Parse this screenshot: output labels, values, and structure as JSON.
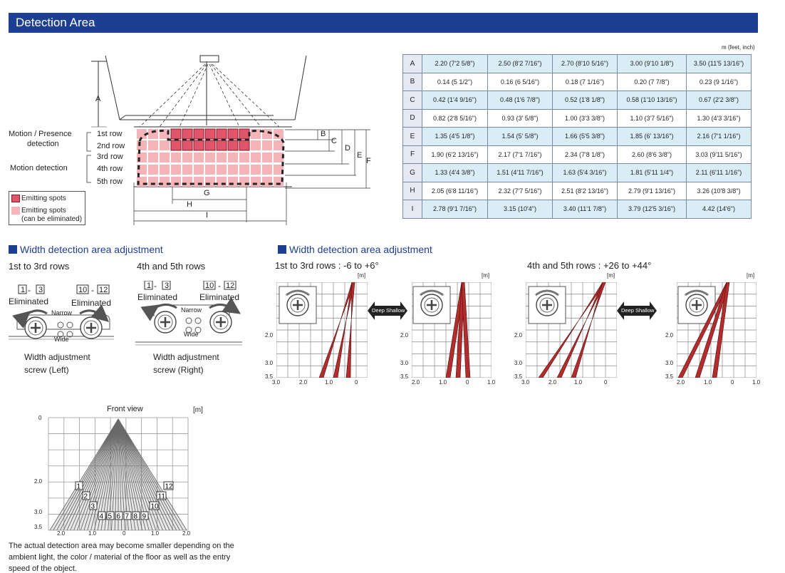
{
  "header": {
    "title": "Detection Area"
  },
  "diagram": {
    "side_labels": {
      "motion_presence": "Motion / Presence",
      "detection": "detection",
      "motion_detection": "Motion detection"
    },
    "rows": [
      "1st row",
      "2nd row",
      "3rd row",
      "4th row",
      "5th row"
    ],
    "letters": {
      "A": "A",
      "B": "B",
      "C": "C",
      "D": "D",
      "E": "E",
      "F": "F",
      "G": "G",
      "H": "H",
      "I": "I"
    },
    "legend": {
      "emitting": "Emitting spots",
      "eliminable_1": "Emitting spots",
      "eliminable_2": "(can be eliminated)",
      "emitting_color": "#d9534f",
      "eliminable_color": "#f5b5b8"
    }
  },
  "table": {
    "unit": "m (feet, inch)",
    "rows": [
      {
        "key": "A",
        "values": [
          "2.20 (7'2 5/8\")",
          "2.50 (8'2 7/16\")",
          "2.70 (8'10 5/16\")",
          "3.00 (9'10 1/8\")",
          "3.50 (11'5 13/16\")"
        ]
      },
      {
        "key": "B",
        "values": [
          "0.14 (5 1/2\")",
          "0.16 (6 5/16\")",
          "0.18 (7 1/16\")",
          "0.20 (7 7/8\")",
          "0.23 (9 1/16\")"
        ]
      },
      {
        "key": "C",
        "values": [
          "0.42 (1'4 9/16\")",
          "0.48 (1'6 7/8\")",
          "0.52 (1'8 1/8\")",
          "0.58 (1'10 13/16\")",
          "0.67 (2'2 3/8\")"
        ]
      },
      {
        "key": "D",
        "values": [
          "0.82 (2'8 5/16\")",
          "0.93 (3' 5/8\")",
          "1.00 (3'3 3/8\")",
          "1.10 (3'7 5/16\")",
          "1.30 (4'3 3/16\")"
        ]
      },
      {
        "key": "E",
        "values": [
          "1.35 (4'5 1/8\")",
          "1.54 (5' 5/8\")",
          "1.66 (5'5 3/8\")",
          "1.85 (6' 13/16\")",
          "2.16 (7'1 1/16\")"
        ]
      },
      {
        "key": "F",
        "values": [
          "1.90 (6'2 13/16\")",
          "2.17 (7'1 7/16\")",
          "2.34 (7'8 1/8\")",
          "2.60 (8'6 3/8\")",
          "3.03 (9'11 5/16\")"
        ]
      },
      {
        "key": "G",
        "values": [
          "1.33 (4'4 3/8\")",
          "1.51 (4'11 7/16\")",
          "1.63 (5'4 3/16\")",
          "1.81 (5'11 1/4\")",
          "2.11 (6'11 1/16\")"
        ]
      },
      {
        "key": "H",
        "values": [
          "2.05 (6'8 11/16\")",
          "2.32 (7'7 5/16\")",
          "2.51 (8'2 13/16\")",
          "2.79 (9'1 13/16\")",
          "3.26 (10'8 3/8\")"
        ]
      },
      {
        "key": "I",
        "values": [
          "2.78 (9'1 7/16\")",
          "3.15 (10'4\")",
          "3.40 (11'1 7/8\")",
          "3.79 (12'5 3/16\")",
          "4.42 (14'6\")"
        ]
      }
    ]
  },
  "width_adj_left": {
    "title": "Width detection area adjustment",
    "group1": {
      "heading": "1st to 3rd rows",
      "box_a1": "1",
      "box_a2": "3",
      "dash": "-",
      "box_b1": "10",
      "box_b2": "12",
      "elim_left": "Eliminated",
      "elim_right": "Eliminated",
      "narrow": "Narrow",
      "wide": "Wide",
      "caption_1": "Width adjustment",
      "caption_2": "screw (Left)"
    },
    "group2": {
      "heading": "4th and 5th rows",
      "box_a1": "1",
      "box_a2": "3",
      "dash": "-",
      "box_b1": "10",
      "box_b2": "12",
      "elim_left": "Eliminated",
      "elim_right": "Eliminated",
      "narrow": "Narrow",
      "wide": "Wide",
      "caption_1": "Width adjustment",
      "caption_2": "screw (Right)"
    }
  },
  "width_adj_right": {
    "title": "Width detection area adjustment",
    "group1_heading": "1st to 3rd rows : -6 to +6°",
    "group2_heading": "4th and 5th rows : +26 to +44°",
    "unit": "[m]",
    "deep_shallow": "Deep Shallow",
    "y_ticks": [
      "2.0",
      "3.0",
      "3.5"
    ],
    "x_ticks_a": [
      "3.0",
      "2.0",
      "1.0",
      "0"
    ],
    "x_ticks_b": [
      "2.0",
      "1.0",
      "0",
      "1.0"
    ]
  },
  "front_view": {
    "title": "Front view",
    "unit": "[m]",
    "y_ticks": [
      "0",
      "2.0",
      "3.0",
      "3.5"
    ],
    "x_ticks": [
      "2.0",
      "1.0",
      "0",
      "1.0",
      "2.0"
    ],
    "spots": [
      "1",
      "2",
      "3",
      "4",
      "5",
      "6",
      "7",
      "8",
      "9",
      "10",
      "11",
      "12"
    ]
  },
  "note": "The actual detection area may become smaller depending on the ambient light, the color / material of the floor as well as the entry speed of the object."
}
